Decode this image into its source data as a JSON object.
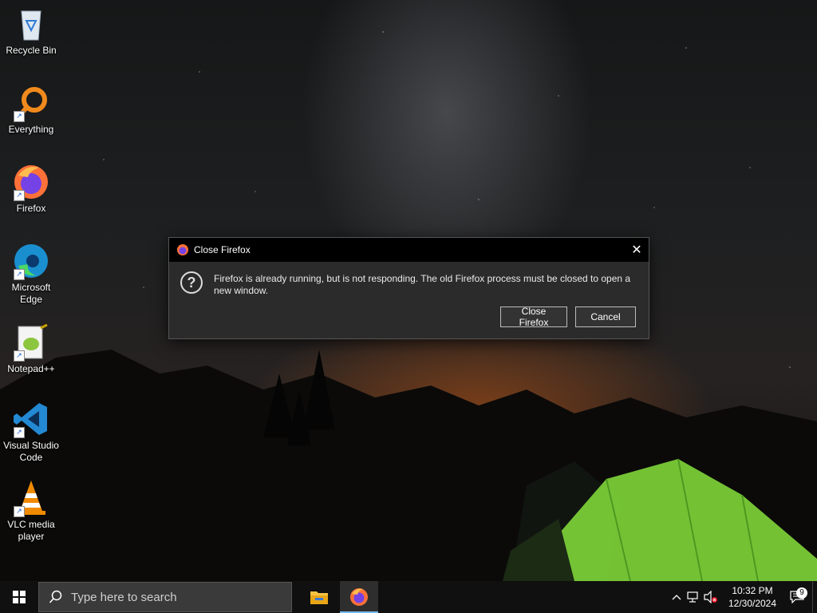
{
  "desktop": {
    "icons": [
      {
        "label": "Recycle Bin",
        "icon": "recycle-bin-icon"
      },
      {
        "label": "Everything",
        "icon": "everything-search-icon"
      },
      {
        "label": "Firefox",
        "icon": "firefox-icon"
      },
      {
        "label": "Microsoft Edge",
        "icon": "edge-icon"
      },
      {
        "label": "Notepad++",
        "icon": "notepadpp-icon"
      },
      {
        "label": "Visual Studio Code",
        "icon": "vscode-icon"
      },
      {
        "label": "VLC media player",
        "icon": "vlc-icon"
      }
    ]
  },
  "dialog": {
    "title": "Close Firefox",
    "message": "Firefox is already running, but is not responding. The old Firefox process must be closed to open a new window.",
    "close_glyph": "✕",
    "buttons": {
      "close_firefox": "Close Firefox",
      "cancel": "Cancel"
    }
  },
  "taskbar": {
    "search_placeholder": "Type here to search",
    "pinned": [
      {
        "name": "file-explorer",
        "active": false
      },
      {
        "name": "firefox",
        "active": true
      }
    ],
    "tray": {
      "time": "10:32 PM",
      "date": "12/30/2024",
      "notification_count": "9"
    }
  },
  "colors": {
    "taskbar_bg": "#101010",
    "dialog_bg": "#2b2b2b",
    "titlebar_bg": "#000000",
    "accent": "#76b9ed",
    "tent": "#7fd63a"
  }
}
